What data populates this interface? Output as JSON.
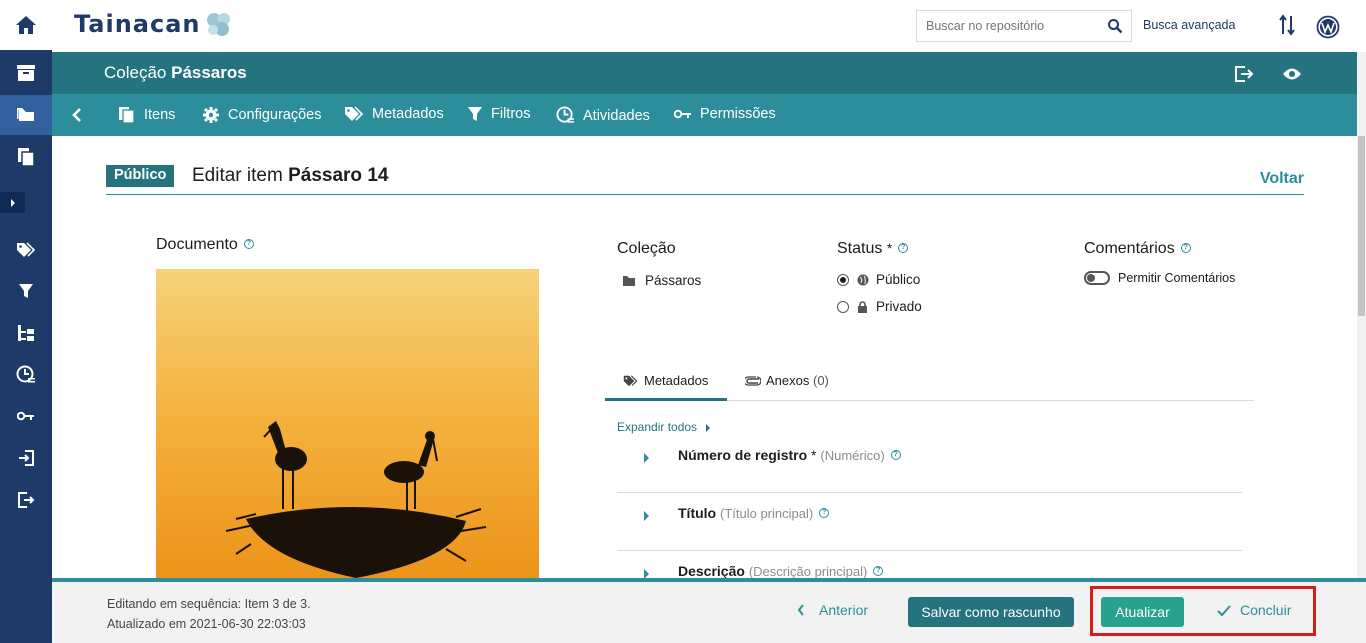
{
  "topbar": {
    "logo_text": "Tainacan",
    "search_placeholder": "Buscar no repositório",
    "advanced_search": "Busca avançada"
  },
  "header": {
    "title_prefix": "Coleção ",
    "title_name": "Pássaros"
  },
  "tabs": [
    {
      "label": "Itens"
    },
    {
      "label": "Configurações"
    },
    {
      "label": "Metadados"
    },
    {
      "label": "Filtros"
    },
    {
      "label": "Atividades"
    },
    {
      "label": "Permissões"
    }
  ],
  "page": {
    "status_badge": "Público",
    "title_prefix": "Editar item ",
    "title_item": "Pássaro 14",
    "back_link": "Voltar"
  },
  "document": {
    "label": "Documento"
  },
  "collection": {
    "label": "Coleção",
    "value": "Pássaros"
  },
  "status": {
    "label": "Status",
    "required_mark": "*",
    "options": [
      {
        "label": "Público",
        "selected": true
      },
      {
        "label": "Privado",
        "selected": false
      }
    ]
  },
  "comments": {
    "label": "Comentários",
    "toggle_label": "Permitir Comentários",
    "enabled": false
  },
  "metadata_tabs": [
    {
      "label": "Metadados",
      "active": true
    },
    {
      "label": "Anexos",
      "count": "(0)",
      "active": false
    }
  ],
  "expand_all": "Expandir todos",
  "fields": [
    {
      "name": "Número de registro",
      "required": "*",
      "type": "(Numérico)"
    },
    {
      "name": "Título",
      "required": "",
      "type": "(Título principal)"
    },
    {
      "name": "Descrição",
      "required": "",
      "type": "(Descrição principal)"
    }
  ],
  "footer": {
    "sequence_text": "Editando em sequência: Item 3 de 3.",
    "updated_text": "Atualizado em 2021-06-30 22:03:03",
    "previous": "Anterior",
    "save_draft": "Salvar como rascunho",
    "update": "Atualizar",
    "finish": "Concluir"
  },
  "colors": {
    "sidebar": "#1e3a68",
    "header": "#24737f",
    "tabs": "#2c8e9b",
    "update_button": "#28a28f",
    "highlight": "#d81b1b"
  }
}
